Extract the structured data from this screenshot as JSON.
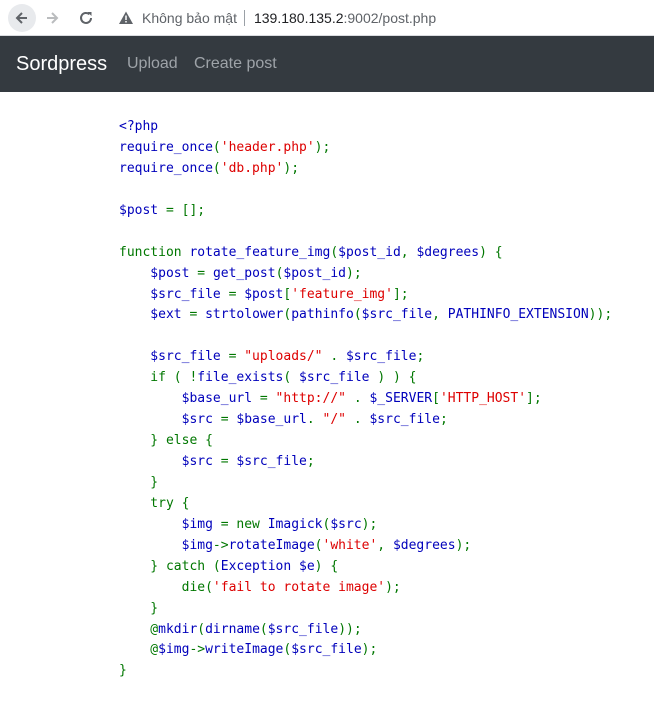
{
  "browser": {
    "not_secure_label": "Không bảo mật",
    "url_host": "139.180.135.2",
    "url_path": ":9002/post.php",
    "icons": [
      "back-arrow-icon",
      "forward-arrow-icon",
      "reload-icon",
      "warning-icon"
    ]
  },
  "navbar": {
    "brand": "Sordpress",
    "links": [
      "Upload",
      "Create post"
    ],
    "background": "#343a40"
  },
  "code_colors": {
    "default": "#0000bb",
    "keyword": "#007700",
    "string": "#dd0000"
  },
  "code_lines": [
    [
      {
        "t": "<?php",
        "c": "v"
      }
    ],
    [
      {
        "t": "require_once",
        "c": "v"
      },
      {
        "t": "(",
        "c": "k"
      },
      {
        "t": "'header.php'",
        "c": "s"
      },
      {
        "t": ");",
        "c": "k"
      }
    ],
    [
      {
        "t": "require_once",
        "c": "v"
      },
      {
        "t": "(",
        "c": "k"
      },
      {
        "t": "'db.php'",
        "c": "s"
      },
      {
        "t": ");",
        "c": "k"
      }
    ],
    [],
    [
      {
        "t": "$post ",
        "c": "v"
      },
      {
        "t": "= [];",
        "c": "k"
      }
    ],
    [],
    [
      {
        "t": "function ",
        "c": "k"
      },
      {
        "t": "rotate_feature_img",
        "c": "v"
      },
      {
        "t": "(",
        "c": "k"
      },
      {
        "t": "$post_id",
        "c": "v"
      },
      {
        "t": ", ",
        "c": "k"
      },
      {
        "t": "$degrees",
        "c": "v"
      },
      {
        "t": ") {",
        "c": "k"
      }
    ],
    [
      {
        "t": "    $post ",
        "c": "v"
      },
      {
        "t": "= ",
        "c": "k"
      },
      {
        "t": "get_post",
        "c": "v"
      },
      {
        "t": "(",
        "c": "k"
      },
      {
        "t": "$post_id",
        "c": "v"
      },
      {
        "t": ");",
        "c": "k"
      }
    ],
    [
      {
        "t": "    $src_file ",
        "c": "v"
      },
      {
        "t": "= ",
        "c": "k"
      },
      {
        "t": "$post",
        "c": "v"
      },
      {
        "t": "[",
        "c": "k"
      },
      {
        "t": "'feature_img'",
        "c": "s"
      },
      {
        "t": "];",
        "c": "k"
      }
    ],
    [
      {
        "t": "    $ext ",
        "c": "v"
      },
      {
        "t": "= ",
        "c": "k"
      },
      {
        "t": "strtolower",
        "c": "v"
      },
      {
        "t": "(",
        "c": "k"
      },
      {
        "t": "pathinfo",
        "c": "v"
      },
      {
        "t": "(",
        "c": "k"
      },
      {
        "t": "$src_file",
        "c": "v"
      },
      {
        "t": ", ",
        "c": "k"
      },
      {
        "t": "PATHINFO_EXTENSION",
        "c": "v"
      },
      {
        "t": "));",
        "c": "k"
      }
    ],
    [],
    [
      {
        "t": "    $src_file ",
        "c": "v"
      },
      {
        "t": "= ",
        "c": "k"
      },
      {
        "t": "\"uploads/\" ",
        "c": "s"
      },
      {
        "t": ". ",
        "c": "k"
      },
      {
        "t": "$src_file",
        "c": "v"
      },
      {
        "t": ";",
        "c": "k"
      }
    ],
    [
      {
        "t": "    if ( !",
        "c": "k"
      },
      {
        "t": "file_exists",
        "c": "v"
      },
      {
        "t": "( ",
        "c": "k"
      },
      {
        "t": "$src_file ",
        "c": "v"
      },
      {
        "t": ") ) {",
        "c": "k"
      }
    ],
    [
      {
        "t": "        $base_url ",
        "c": "v"
      },
      {
        "t": "= ",
        "c": "k"
      },
      {
        "t": "\"http://\" ",
        "c": "s"
      },
      {
        "t": ". ",
        "c": "k"
      },
      {
        "t": "$_SERVER",
        "c": "v"
      },
      {
        "t": "[",
        "c": "k"
      },
      {
        "t": "'HTTP_HOST'",
        "c": "s"
      },
      {
        "t": "];",
        "c": "k"
      }
    ],
    [
      {
        "t": "        $src ",
        "c": "v"
      },
      {
        "t": "= ",
        "c": "k"
      },
      {
        "t": "$base_url",
        "c": "v"
      },
      {
        "t": ". ",
        "c": "k"
      },
      {
        "t": "\"/\" ",
        "c": "s"
      },
      {
        "t": ". ",
        "c": "k"
      },
      {
        "t": "$src_file",
        "c": "v"
      },
      {
        "t": ";",
        "c": "k"
      }
    ],
    [
      {
        "t": "    } else {",
        "c": "k"
      }
    ],
    [
      {
        "t": "        $src ",
        "c": "v"
      },
      {
        "t": "= ",
        "c": "k"
      },
      {
        "t": "$src_file",
        "c": "v"
      },
      {
        "t": ";",
        "c": "k"
      }
    ],
    [
      {
        "t": "    }",
        "c": "k"
      }
    ],
    [
      {
        "t": "    try {",
        "c": "k"
      }
    ],
    [
      {
        "t": "        $img ",
        "c": "v"
      },
      {
        "t": "= new ",
        "c": "k"
      },
      {
        "t": "Imagick",
        "c": "v"
      },
      {
        "t": "(",
        "c": "k"
      },
      {
        "t": "$src",
        "c": "v"
      },
      {
        "t": ");",
        "c": "k"
      }
    ],
    [
      {
        "t": "        $img",
        "c": "v"
      },
      {
        "t": "->",
        "c": "k"
      },
      {
        "t": "rotateImage",
        "c": "v"
      },
      {
        "t": "(",
        "c": "k"
      },
      {
        "t": "'white'",
        "c": "s"
      },
      {
        "t": ", ",
        "c": "k"
      },
      {
        "t": "$degrees",
        "c": "v"
      },
      {
        "t": ");",
        "c": "k"
      }
    ],
    [
      {
        "t": "    } catch (",
        "c": "k"
      },
      {
        "t": "Exception $e",
        "c": "v"
      },
      {
        "t": ") {",
        "c": "k"
      }
    ],
    [
      {
        "t": "        die",
        "c": "k"
      },
      {
        "t": "(",
        "c": "k"
      },
      {
        "t": "'fail to rotate image'",
        "c": "s"
      },
      {
        "t": ");",
        "c": "k"
      }
    ],
    [
      {
        "t": "    }",
        "c": "k"
      }
    ],
    [
      {
        "t": "    @",
        "c": "k"
      },
      {
        "t": "mkdir",
        "c": "v"
      },
      {
        "t": "(",
        "c": "k"
      },
      {
        "t": "dirname",
        "c": "v"
      },
      {
        "t": "(",
        "c": "k"
      },
      {
        "t": "$src_file",
        "c": "v"
      },
      {
        "t": "));",
        "c": "k"
      }
    ],
    [
      {
        "t": "    @",
        "c": "k"
      },
      {
        "t": "$img",
        "c": "v"
      },
      {
        "t": "->",
        "c": "k"
      },
      {
        "t": "writeImage",
        "c": "v"
      },
      {
        "t": "(",
        "c": "k"
      },
      {
        "t": "$src_file",
        "c": "v"
      },
      {
        "t": ");",
        "c": "k"
      }
    ],
    [
      {
        "t": "}",
        "c": "k"
      }
    ]
  ]
}
